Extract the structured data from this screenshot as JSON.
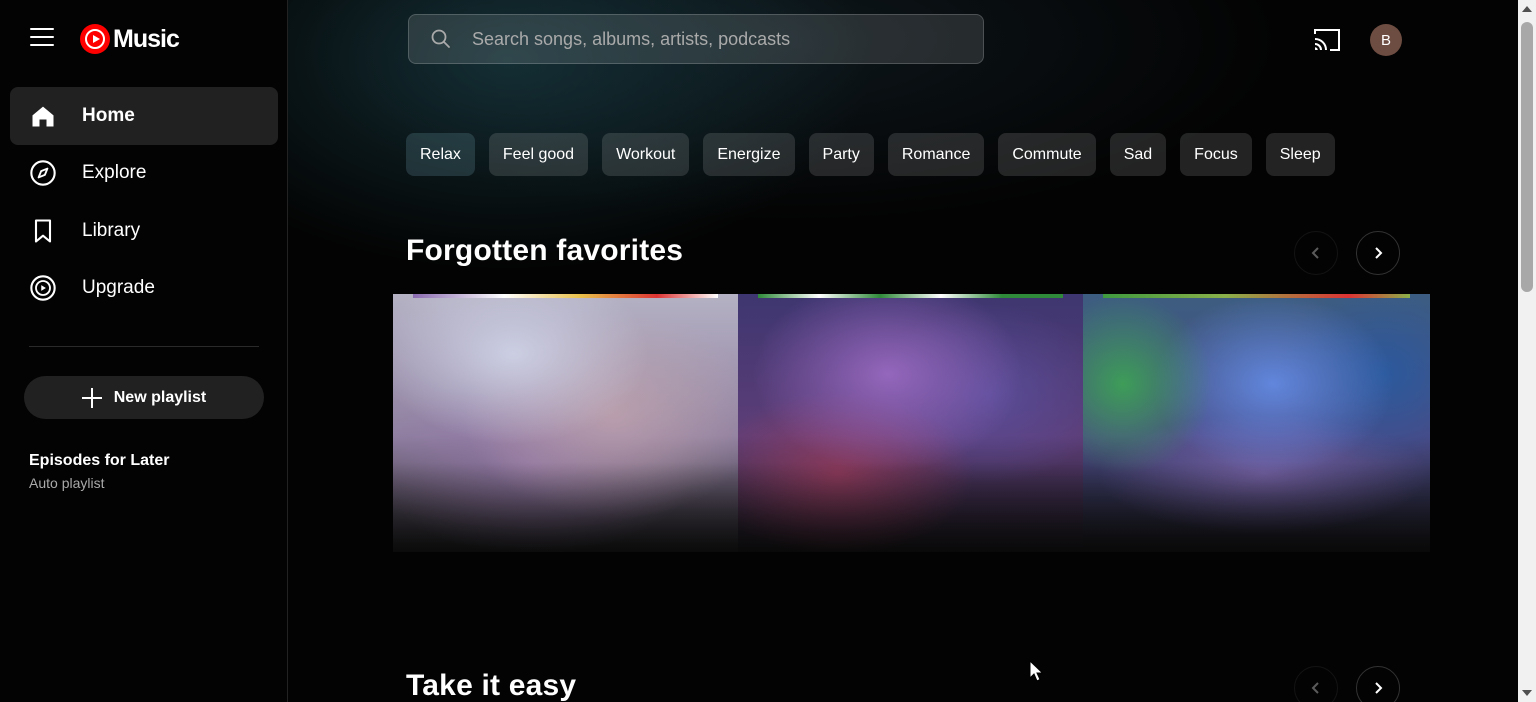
{
  "app": {
    "logo_text": "Music",
    "brand_color": "#ff0000"
  },
  "sidebar": {
    "items": [
      {
        "label": "Home",
        "icon": "home-icon",
        "active": true
      },
      {
        "label": "Explore",
        "icon": "compass-icon",
        "active": false
      },
      {
        "label": "Library",
        "icon": "bookmark-icon",
        "active": false
      },
      {
        "label": "Upgrade",
        "icon": "upgrade-icon",
        "active": false
      }
    ],
    "new_playlist_label": "New playlist",
    "playlists": [
      {
        "title": "Episodes for Later",
        "subtitle": "Auto playlist"
      }
    ]
  },
  "header": {
    "search_placeholder": "Search songs, albums, artists, podcasts",
    "avatar_initial": "B"
  },
  "chips": [
    "Relax",
    "Feel good",
    "Workout",
    "Energize",
    "Party",
    "Romance",
    "Commute",
    "Sad",
    "Focus",
    "Sleep"
  ],
  "sections": [
    {
      "title": "Forgotten favorites"
    },
    {
      "title": "Take it easy"
    }
  ]
}
